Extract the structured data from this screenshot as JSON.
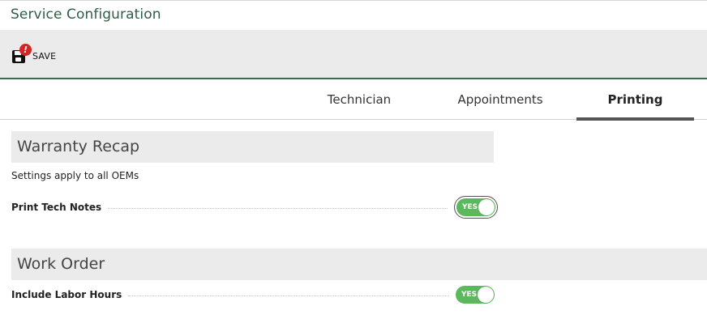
{
  "page": {
    "title": "Service Configuration"
  },
  "toolbar": {
    "save_label": "SAVE",
    "alert_badge": "!"
  },
  "tabs": [
    {
      "label": "Technician",
      "active": false
    },
    {
      "label": "Appointments",
      "active": false
    },
    {
      "label": "Printing",
      "active": true
    }
  ],
  "sections": {
    "warranty_recap": {
      "title": "Warranty Recap",
      "note": "Settings apply to all OEMs",
      "settings": [
        {
          "label": "Print Tech Notes",
          "value": "YES"
        }
      ]
    },
    "work_order": {
      "title": "Work Order",
      "settings": [
        {
          "label": "Include Labor Hours",
          "value": "YES"
        }
      ]
    }
  },
  "colors": {
    "accent_green": "#2e5e45",
    "toggle_on": "#5cb85c",
    "alert_red": "#d42424"
  }
}
